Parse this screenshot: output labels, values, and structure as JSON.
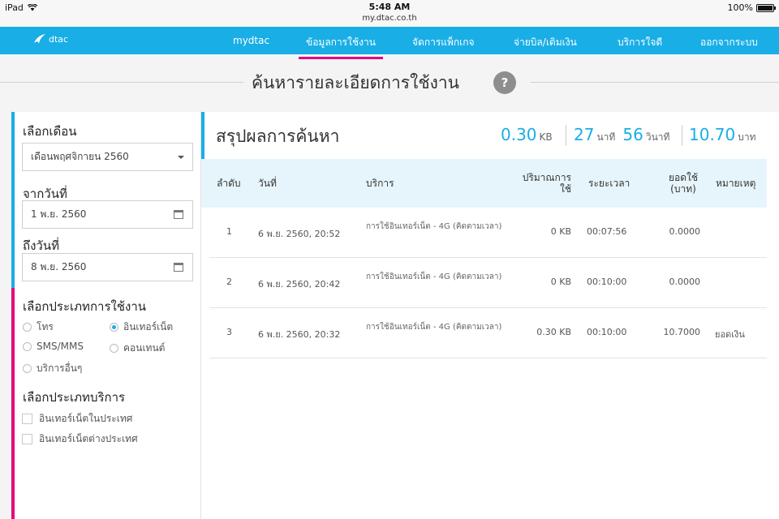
{
  "status_bar": {
    "device": "iPad",
    "time": "5:48 AM",
    "url": "my.dtac.co.th",
    "battery": "100%",
    "battery_level": 1.0
  },
  "nav": {
    "logo_text": "dtac",
    "items": [
      {
        "label": "mydtac",
        "active": false
      },
      {
        "label": "ข้อมูลการใช้งาน",
        "active": true
      },
      {
        "label": "จัดการแพ็กเกจ",
        "active": false
      },
      {
        "label": "จ่ายบิล/เติมเงิน",
        "active": false
      },
      {
        "label": "บริการใจดี",
        "active": false
      },
      {
        "label": "ออกจากระบบ",
        "active": false
      }
    ]
  },
  "page_title": "ค้นหารายละเอียดการใช้งาน",
  "help_symbol": "?",
  "filters": {
    "month_label": "เลือกเดือน",
    "month_value": "เดือนพฤศจิกายน 2560",
    "from_label": "จากวันที่",
    "from_value": "1 พ.ย. 2560",
    "to_label": "ถึงวันที่",
    "to_value": "8 พ.ย. 2560",
    "usage_type_label": "เลือกประเภทการใช้งาน",
    "usage_types": [
      {
        "label": "โทร",
        "selected": false
      },
      {
        "label": "อินเทอร์เน็ต",
        "selected": true
      },
      {
        "label": "SMS/MMS",
        "selected": false
      },
      {
        "label": "คอนเทนต์",
        "selected": false
      },
      {
        "label": "บริการอื่นๆ",
        "selected": false
      }
    ],
    "service_type_label": "เลือกประเภทบริการ",
    "service_types": [
      {
        "label": "อินเทอร์เน็ตในประเทศ",
        "checked": false
      },
      {
        "label": "อินเทอร์เน็ตต่างประเทศ",
        "checked": false
      }
    ]
  },
  "results": {
    "title": "สรุปผลการค้นหา",
    "summary": {
      "data_value": "0.30",
      "data_unit": "KB",
      "minutes_value": "27",
      "minutes_unit": "นาที",
      "seconds_value": "56",
      "seconds_unit": "วินาที",
      "amount_value": "10.70",
      "amount_unit": "บาท"
    },
    "columns": [
      "ลำดับ",
      "วันที่",
      "บริการ",
      "ปริมาณการใช้",
      "ระยะเวลา",
      "ยอดใช้ (บาท)",
      "หมายเหตุ"
    ],
    "rows": [
      {
        "no": "1",
        "date": "6 พ.ย. 2560, 20:52",
        "service": "การใช้อินเทอร์เน็ต - 4G (คิดตามเวลา)",
        "volume": "0 KB",
        "duration": "00:07:56",
        "amount": "0.0000",
        "note": ""
      },
      {
        "no": "2",
        "date": "6 พ.ย. 2560, 20:42",
        "service": "การใช้อินเทอร์เน็ต - 4G (คิดตามเวลา)",
        "volume": "0 KB",
        "duration": "00:10:00",
        "amount": "0.0000",
        "note": ""
      },
      {
        "no": "3",
        "date": "6 พ.ย. 2560, 20:32",
        "service": "การใช้อินเทอร์เน็ต - 4G (คิดตามเวลา)",
        "volume": "0.30 KB",
        "duration": "00:10:00",
        "amount": "10.7000",
        "note": "ยอดเงิน"
      }
    ]
  }
}
